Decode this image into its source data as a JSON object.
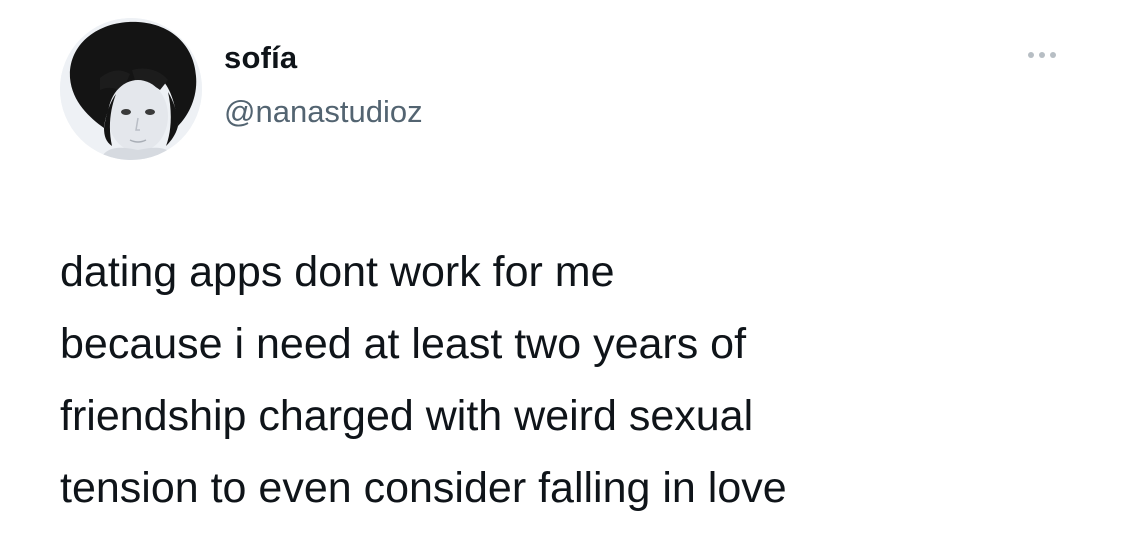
{
  "tweet": {
    "author": {
      "display_name": "sofía",
      "handle": "@nanastudioz",
      "avatar": "profile-photo"
    },
    "more_icon": "more-horizontal-icon",
    "text_lines": [
      "dating apps dont work for me",
      "because i need at least two years of",
      "friendship charged with weird sexual",
      "tension to even consider falling in love"
    ]
  },
  "colors": {
    "text_primary": "#0f1419",
    "text_secondary": "#536471",
    "background": "#ffffff",
    "more_dots": "#b7bec4"
  }
}
